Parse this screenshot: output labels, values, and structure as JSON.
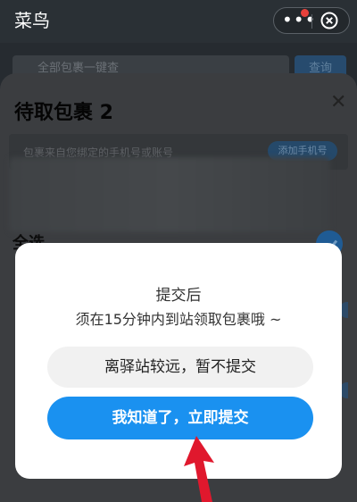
{
  "app": {
    "title": "菜鸟"
  },
  "capsule": {
    "more_icon": "more-horizontal-icon",
    "close_icon": "close-circle-icon",
    "badge_color": "#e8413b"
  },
  "search": {
    "placeholder": "全部包裹一键查",
    "button_label": "查询"
  },
  "sheet": {
    "title": "待取包裹 2",
    "notice": "包裹来自您绑定的手机号或账号",
    "add_phone_label": "添加手机号",
    "select_all_label": "全选"
  },
  "dialog": {
    "title": "提交后",
    "message": "须在15分钟内到站领取包裹哦 ~",
    "secondary_label": "离驿站较远，暂不提交",
    "primary_label": "我知道了，立即提交",
    "primary_color": "#1a91f0"
  },
  "annotation": {
    "icon": "red-arrow-icon",
    "color": "#e0182d"
  }
}
